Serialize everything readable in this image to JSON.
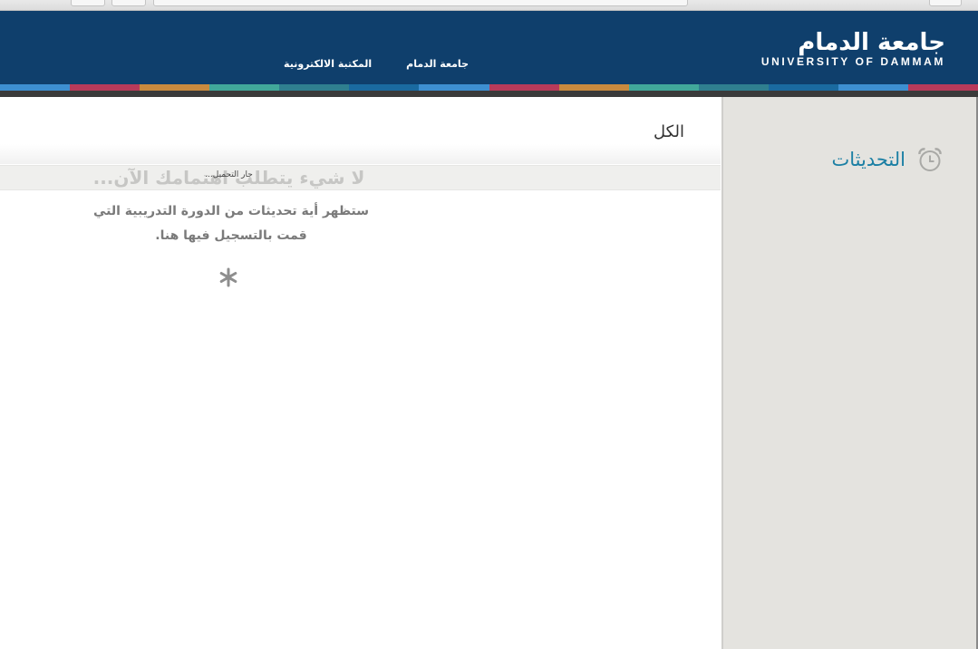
{
  "header": {
    "logo_ar": "جامعة الدمام",
    "logo_en": "UNIVERSITY OF DAMMAM",
    "nav": [
      {
        "label": "جامعة الدمام"
      },
      {
        "label": "المكتبة الالكترونية"
      }
    ],
    "stripe_colors": [
      "#3d8fd1",
      "#b83a5a",
      "#c98a3e",
      "#41a89a",
      "#2f7f8f",
      "#1a6aa0",
      "#3d8fd1",
      "#b83a5a",
      "#c98a3e",
      "#41a89a",
      "#2f7f8f",
      "#1a6aa0",
      "#3d8fd1",
      "#b83a5a"
    ]
  },
  "sidebar": {
    "updates_label": "التحديثات",
    "updates_icon": "alarm-clock-icon"
  },
  "main": {
    "filter_tab": "الكل",
    "empty_title": "لا شيء يتطلب اهتمامك الآن...",
    "loading": "جار التحميل...",
    "empty_desc": "ستظهر أية تحديثات من الدورة التدريبية التي قمت بالتسجيل فيها هنا.",
    "spinner_icon": "asterisk-spinner-icon"
  },
  "colors": {
    "header_bg": "#0f3f6c",
    "accent": "#1b7fa4",
    "sidebar_bg": "#e4e3df"
  }
}
